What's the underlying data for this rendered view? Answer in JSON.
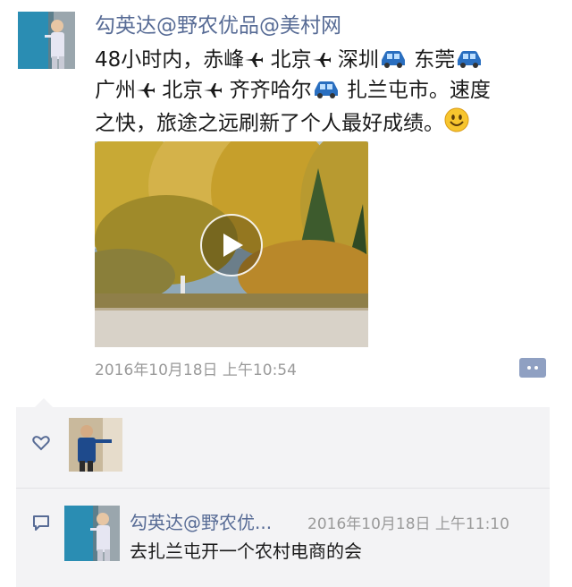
{
  "post": {
    "author_name": "勾英达@野农优品@美村网",
    "text": {
      "line1": {
        "s1": "48小时内，赤峰",
        "s2": " 北京",
        "s3": " 深圳",
        "s4": " 东莞"
      },
      "line2": {
        "s1": "广州",
        "s2": " 北京",
        "s3": " 齐齐哈尔",
        "s4": " 扎兰屯市。速度"
      },
      "line3": {
        "s1": "之快，旅途之远刷新了个人最好成绩。"
      }
    },
    "timestamp": "2016年10月18日 上午10:54"
  },
  "interactions": {
    "comment": {
      "author": "勾英达@野农优...",
      "time": "2016年10月18日 上午11:10",
      "text": "去扎兰屯开一个农村电商的会"
    }
  },
  "colors": {
    "link": "#576b95",
    "panel_bg": "#f3f3f5",
    "muted": "#9a9a9a"
  },
  "icons": [
    "play-icon",
    "comment-menu-icon",
    "heart-icon",
    "comment-icon",
    "airplane-icon",
    "car-icon",
    "smiley-icon"
  ]
}
